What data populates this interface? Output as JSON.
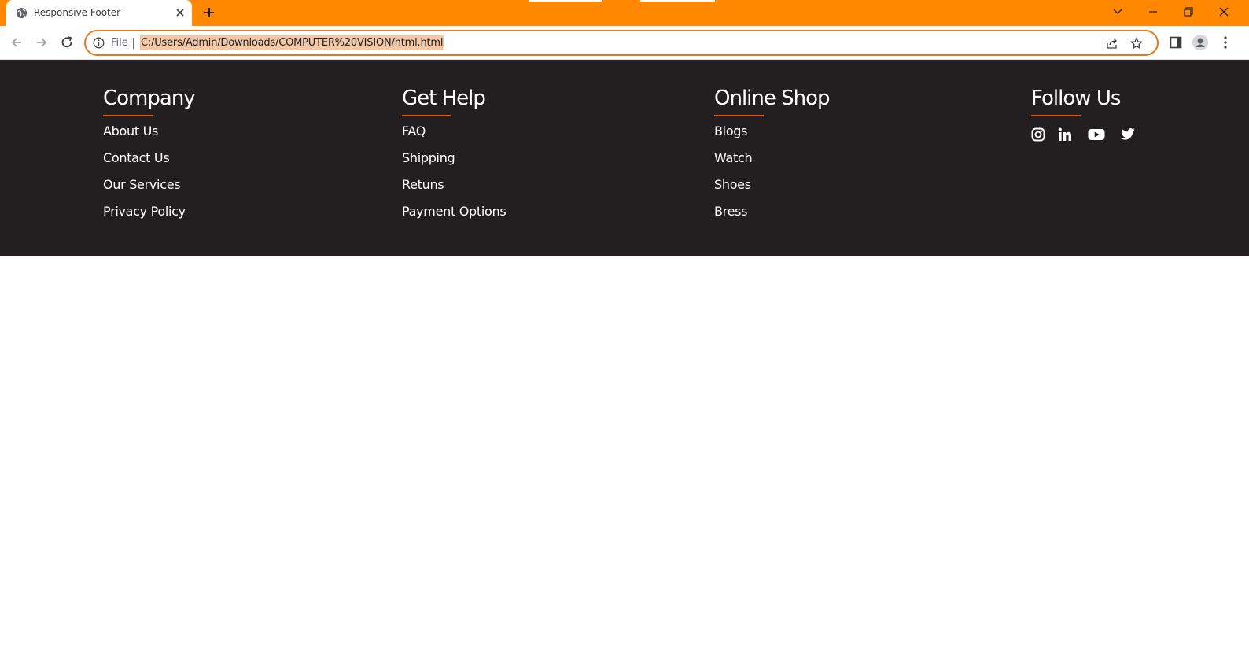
{
  "browser": {
    "tab_title": "Responsive Footer",
    "file_label": "File",
    "url": "C:/Users/Admin/Downloads/COMPUTER%20VISION/html.html",
    "accent_color": "#ff8800"
  },
  "footer": {
    "background": "#231f20",
    "accent": "#e35d14",
    "columns": [
      {
        "heading": "Company",
        "links": [
          "About Us",
          "Contact Us",
          "Our Services",
          "Privacy Policy"
        ]
      },
      {
        "heading": "Get Help",
        "links": [
          "FAQ",
          "Shipping",
          "Retuns",
          "Payment Options"
        ]
      },
      {
        "heading": "Online Shop",
        "links": [
          "Blogs",
          "Watch",
          "Shoes",
          "Bress"
        ]
      },
      {
        "heading": "Follow Us",
        "social": [
          "instagram-icon",
          "linkedin-icon",
          "youtube-icon",
          "twitter-icon"
        ]
      }
    ]
  }
}
